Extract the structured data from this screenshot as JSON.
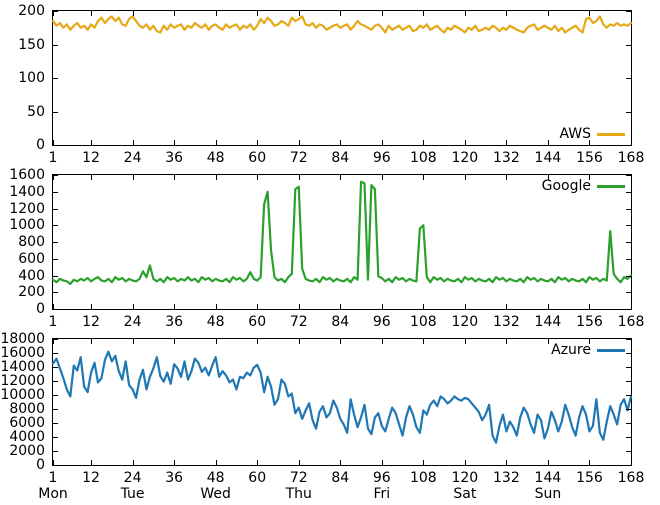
{
  "chart_data": [
    {
      "type": "line",
      "name": "AWS",
      "color": "#e6a817",
      "xlabel": "",
      "ylabel": "",
      "xlim": [
        1,
        168
      ],
      "ylim": [
        0,
        200
      ],
      "xticks": [
        1,
        12,
        24,
        36,
        48,
        60,
        72,
        84,
        96,
        108,
        120,
        132,
        144,
        156,
        168
      ],
      "yticks": [
        0,
        50,
        100,
        150,
        200
      ],
      "legend": "AWS",
      "x": [
        1,
        2,
        3,
        4,
        5,
        6,
        7,
        8,
        9,
        10,
        11,
        12,
        13,
        14,
        15,
        16,
        17,
        18,
        19,
        20,
        21,
        22,
        23,
        24,
        25,
        26,
        27,
        28,
        29,
        30,
        31,
        32,
        33,
        34,
        35,
        36,
        37,
        38,
        39,
        40,
        41,
        42,
        43,
        44,
        45,
        46,
        47,
        48,
        49,
        50,
        51,
        52,
        53,
        54,
        55,
        56,
        57,
        58,
        59,
        60,
        61,
        62,
        63,
        64,
        65,
        66,
        67,
        68,
        69,
        70,
        71,
        72,
        73,
        74,
        75,
        76,
        77,
        78,
        79,
        80,
        81,
        82,
        83,
        84,
        85,
        86,
        87,
        88,
        89,
        90,
        91,
        92,
        93,
        94,
        95,
        96,
        97,
        98,
        99,
        100,
        101,
        102,
        103,
        104,
        105,
        106,
        107,
        108,
        109,
        110,
        111,
        112,
        113,
        114,
        115,
        116,
        117,
        118,
        119,
        120,
        121,
        122,
        123,
        124,
        125,
        126,
        127,
        128,
        129,
        130,
        131,
        132,
        133,
        134,
        135,
        136,
        137,
        138,
        139,
        140,
        141,
        142,
        143,
        144,
        145,
        146,
        147,
        148,
        149,
        150,
        151,
        152,
        153,
        154,
        155,
        156,
        157,
        158,
        159,
        160,
        161,
        162,
        163,
        164,
        165,
        166,
        167,
        168
      ],
      "values": [
        185,
        178,
        182,
        175,
        180,
        172,
        178,
        182,
        175,
        178,
        172,
        180,
        175,
        185,
        190,
        182,
        188,
        192,
        185,
        190,
        180,
        178,
        188,
        192,
        185,
        178,
        175,
        180,
        172,
        178,
        170,
        168,
        178,
        172,
        180,
        175,
        178,
        180,
        172,
        178,
        175,
        182,
        178,
        175,
        180,
        172,
        178,
        180,
        175,
        172,
        180,
        175,
        178,
        180,
        172,
        178,
        175,
        180,
        172,
        178,
        188,
        182,
        190,
        185,
        178,
        180,
        185,
        182,
        178,
        190,
        185,
        188,
        192,
        180,
        178,
        182,
        175,
        180,
        178,
        172,
        175,
        178,
        180,
        175,
        178,
        180,
        172,
        178,
        185,
        180,
        178,
        175,
        172,
        178,
        180,
        175,
        168,
        178,
        172,
        175,
        178,
        172,
        175,
        178,
        170,
        172,
        178,
        175,
        180,
        172,
        175,
        178,
        172,
        168,
        175,
        172,
        178,
        175,
        172,
        168,
        175,
        172,
        178,
        170,
        172,
        175,
        172,
        178,
        175,
        170,
        175,
        172,
        178,
        175,
        172,
        170,
        168,
        175,
        178,
        180,
        172,
        175,
        178,
        175,
        172,
        178,
        170,
        175,
        168,
        172,
        175,
        178,
        172,
        168,
        188,
        190,
        182,
        185,
        192,
        180,
        175,
        180,
        178,
        182,
        178,
        180,
        178,
        182
      ]
    },
    {
      "type": "line",
      "name": "Google",
      "color": "#2ca02c",
      "xlabel": "",
      "ylabel": "",
      "xlim": [
        1,
        168
      ],
      "ylim": [
        0,
        1600
      ],
      "xticks": [
        1,
        12,
        24,
        36,
        48,
        60,
        72,
        84,
        96,
        108,
        120,
        132,
        144,
        156,
        168
      ],
      "yticks": [
        0,
        200,
        400,
        600,
        800,
        1000,
        1200,
        1400,
        1600
      ],
      "legend": "Google",
      "x": [
        1,
        2,
        3,
        4,
        5,
        6,
        7,
        8,
        9,
        10,
        11,
        12,
        13,
        14,
        15,
        16,
        17,
        18,
        19,
        20,
        21,
        22,
        23,
        24,
        25,
        26,
        27,
        28,
        29,
        30,
        31,
        32,
        33,
        34,
        35,
        36,
        37,
        38,
        39,
        40,
        41,
        42,
        43,
        44,
        45,
        46,
        47,
        48,
        49,
        50,
        51,
        52,
        53,
        54,
        55,
        56,
        57,
        58,
        59,
        60,
        61,
        62,
        63,
        64,
        65,
        66,
        67,
        68,
        69,
        70,
        71,
        72,
        73,
        74,
        75,
        76,
        77,
        78,
        79,
        80,
        81,
        82,
        83,
        84,
        85,
        86,
        87,
        88,
        89,
        90,
        91,
        92,
        93,
        94,
        95,
        96,
        97,
        98,
        99,
        100,
        101,
        102,
        103,
        104,
        105,
        106,
        107,
        108,
        109,
        110,
        111,
        112,
        113,
        114,
        115,
        116,
        117,
        118,
        119,
        120,
        121,
        122,
        123,
        124,
        125,
        126,
        127,
        128,
        129,
        130,
        131,
        132,
        133,
        134,
        135,
        136,
        137,
        138,
        139,
        140,
        141,
        142,
        143,
        144,
        145,
        146,
        147,
        148,
        149,
        150,
        151,
        152,
        153,
        154,
        155,
        156,
        157,
        158,
        159,
        160,
        161,
        162,
        163,
        164,
        165,
        166,
        167,
        168
      ],
      "values": [
        350,
        320,
        360,
        340,
        330,
        300,
        350,
        330,
        360,
        340,
        370,
        330,
        360,
        380,
        340,
        330,
        360,
        320,
        380,
        350,
        370,
        330,
        360,
        340,
        330,
        360,
        450,
        380,
        520,
        360,
        330,
        360,
        320,
        380,
        350,
        370,
        330,
        360,
        340,
        380,
        340,
        360,
        320,
        380,
        350,
        370,
        330,
        360,
        340,
        330,
        360,
        320,
        380,
        350,
        370,
        330,
        360,
        440,
        360,
        340,
        380,
        1250,
        1400,
        700,
        380,
        340,
        360,
        320,
        380,
        420,
        1430,
        1460,
        480,
        360,
        340,
        330,
        360,
        320,
        380,
        350,
        370,
        330,
        360,
        340,
        330,
        360,
        320,
        380,
        350,
        1520,
        1500,
        350,
        1480,
        1430,
        390,
        370,
        330,
        360,
        320,
        380,
        350,
        370,
        330,
        360,
        340,
        330,
        960,
        1000,
        380,
        320,
        380,
        350,
        370,
        330,
        360,
        340,
        330,
        360,
        320,
        380,
        350,
        370,
        330,
        360,
        340,
        330,
        360,
        320,
        380,
        350,
        370,
        330,
        360,
        340,
        330,
        360,
        320,
        380,
        350,
        370,
        330,
        360,
        340,
        330,
        360,
        320,
        380,
        350,
        370,
        330,
        360,
        340,
        330,
        360,
        320,
        380,
        350,
        370,
        330,
        360,
        340,
        930,
        420,
        360,
        320,
        380,
        360,
        400
      ]
    },
    {
      "type": "line",
      "name": "Azure",
      "color": "#1f77b4",
      "xlabel": "",
      "ylabel": "",
      "xlim": [
        1,
        168
      ],
      "ylim": [
        0,
        18000
      ],
      "xticks": [
        1,
        12,
        24,
        36,
        48,
        60,
        72,
        84,
        96,
        108,
        120,
        132,
        144,
        156,
        168
      ],
      "yticks": [
        0,
        2000,
        4000,
        6000,
        8000,
        10000,
        12000,
        14000,
        16000,
        18000
      ],
      "legend": "Azure",
      "day_labels": [
        "Mon",
        "Tue",
        "Wed",
        "Thu",
        "Fri",
        "Sat",
        "Sun"
      ],
      "day_label_positions": [
        1,
        24,
        48,
        72,
        96,
        120,
        144
      ],
      "x": [
        1,
        2,
        3,
        4,
        5,
        6,
        7,
        8,
        9,
        10,
        11,
        12,
        13,
        14,
        15,
        16,
        17,
        18,
        19,
        20,
        21,
        22,
        23,
        24,
        25,
        26,
        27,
        28,
        29,
        30,
        31,
        32,
        33,
        34,
        35,
        36,
        37,
        38,
        39,
        40,
        41,
        42,
        43,
        44,
        45,
        46,
        47,
        48,
        49,
        50,
        51,
        52,
        53,
        54,
        55,
        56,
        57,
        58,
        59,
        60,
        61,
        62,
        63,
        64,
        65,
        66,
        67,
        68,
        69,
        70,
        71,
        72,
        73,
        74,
        75,
        76,
        77,
        78,
        79,
        80,
        81,
        82,
        83,
        84,
        85,
        86,
        87,
        88,
        89,
        90,
        91,
        92,
        93,
        94,
        95,
        96,
        97,
        98,
        99,
        100,
        101,
        102,
        103,
        104,
        105,
        106,
        107,
        108,
        109,
        110,
        111,
        112,
        113,
        114,
        115,
        116,
        117,
        118,
        119,
        120,
        121,
        122,
        123,
        124,
        125,
        126,
        127,
        128,
        129,
        130,
        131,
        132,
        133,
        134,
        135,
        136,
        137,
        138,
        139,
        140,
        141,
        142,
        143,
        144,
        145,
        146,
        147,
        148,
        149,
        150,
        151,
        152,
        153,
        154,
        155,
        156,
        157,
        158,
        159,
        160,
        161,
        162,
        163,
        164,
        165,
        166,
        167,
        168
      ],
      "values": [
        14500,
        15200,
        13800,
        12400,
        10800,
        9800,
        14200,
        13500,
        15400,
        11200,
        10400,
        13200,
        14600,
        11800,
        12400,
        15000,
        16200,
        14800,
        15600,
        13400,
        12200,
        14800,
        11400,
        10800,
        9600,
        12200,
        13600,
        10800,
        12600,
        13800,
        15400,
        12700,
        11900,
        13200,
        11600,
        14400,
        13800,
        12600,
        14800,
        12200,
        13400,
        15200,
        14600,
        13300,
        13900,
        12800,
        14200,
        15400,
        12600,
        13400,
        12800,
        11800,
        12200,
        10800,
        12600,
        12400,
        13200,
        12800,
        13900,
        14300,
        13200,
        10400,
        12600,
        11200,
        8600,
        9400,
        12200,
        11600,
        9800,
        10200,
        7400,
        8200,
        6600,
        7800,
        8800,
        6400,
        5200,
        7600,
        8400,
        6800,
        7400,
        9200,
        8200,
        6600,
        5800,
        4600,
        9400,
        7200,
        5400,
        6800,
        8600,
        5200,
        4400,
        6800,
        7400,
        5600,
        4800,
        6600,
        8200,
        7400,
        5800,
        4200,
        6800,
        8400,
        7200,
        5400,
        4600,
        7800,
        7200,
        8600,
        9200,
        8400,
        9800,
        9400,
        8800,
        9200,
        9800,
        9400,
        9200,
        9600,
        9400,
        8800,
        8200,
        7600,
        6400,
        7200,
        8600,
        4200,
        3200,
        5600,
        7200,
        4800,
        6200,
        5400,
        4200,
        6800,
        8200,
        7400,
        5800,
        4600,
        7200,
        6400,
        3800,
        5200,
        7600,
        6400,
        4800,
        6200,
        8600,
        7200,
        5400,
        4200,
        6800,
        8400,
        7200,
        4800,
        5600,
        9400,
        4600,
        3600,
        6200,
        8400,
        7200,
        5800,
        8600,
        9400,
        7800,
        9800
      ]
    }
  ]
}
